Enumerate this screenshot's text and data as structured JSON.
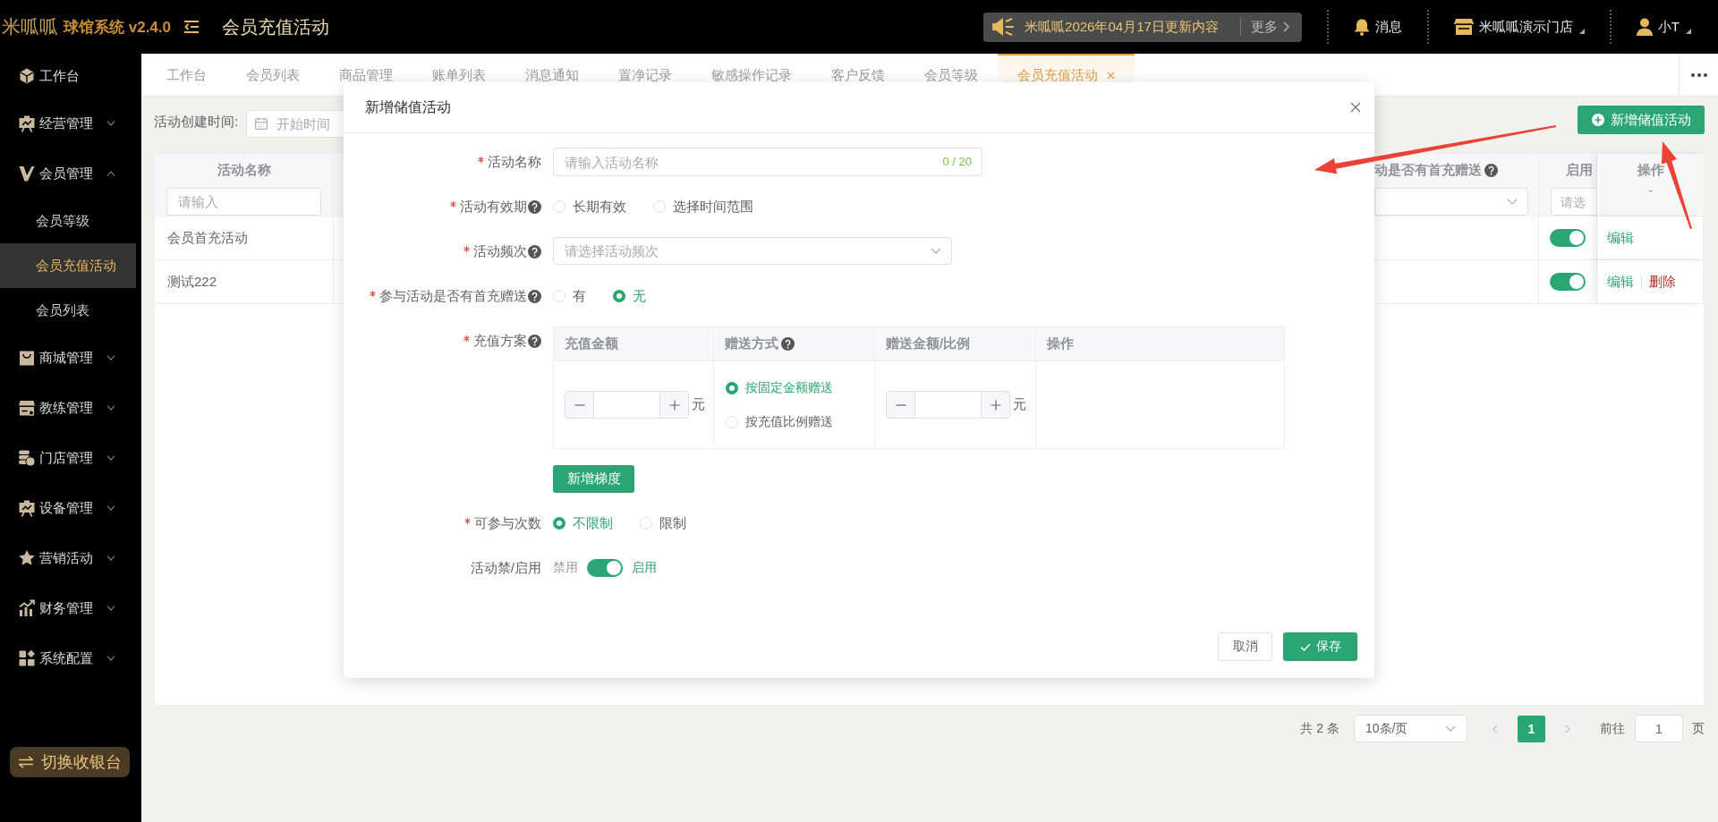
{
  "header": {
    "logo": "米呱呱",
    "app_name": "球馆系统 v2.4.0",
    "page_title": "会员充值活动",
    "notice": {
      "text": "米呱呱2026年04月17日更新内容",
      "more": "更多"
    },
    "messages": "消息",
    "store": "米呱呱演示门店",
    "user": "小T"
  },
  "sidebar": {
    "items": [
      {
        "label": "工作台",
        "kind": "link",
        "selected": false
      },
      {
        "label": "经营管理",
        "kind": "group",
        "expanded": false,
        "selected": false
      },
      {
        "label": "会员管理",
        "kind": "group",
        "expanded": true,
        "selected": false,
        "children": [
          {
            "label": "会员等级",
            "selected": false
          },
          {
            "label": "会员充值活动",
            "selected": true
          },
          {
            "label": "会员列表",
            "selected": false
          }
        ]
      },
      {
        "label": "商城管理",
        "kind": "group",
        "expanded": false,
        "selected": false
      },
      {
        "label": "教练管理",
        "kind": "group",
        "expanded": false,
        "selected": false
      },
      {
        "label": "门店管理",
        "kind": "group",
        "expanded": false,
        "selected": false
      },
      {
        "label": "设备管理",
        "kind": "group",
        "expanded": false,
        "selected": false
      },
      {
        "label": "营销活动",
        "kind": "group",
        "expanded": false,
        "selected": false
      },
      {
        "label": "财务管理",
        "kind": "group",
        "expanded": false,
        "selected": false
      },
      {
        "label": "系统配置",
        "kind": "group",
        "expanded": false,
        "selected": false
      }
    ],
    "switch_button": "切换收银台"
  },
  "tabs": [
    {
      "label": "工作台",
      "selected": false
    },
    {
      "label": "会员列表",
      "selected": false
    },
    {
      "label": "商品管理",
      "selected": false
    },
    {
      "label": "账单列表",
      "selected": false
    },
    {
      "label": "消息通知",
      "selected": false
    },
    {
      "label": "置净记录",
      "selected": false
    },
    {
      "label": "敏感操作记录",
      "selected": false
    },
    {
      "label": "客户反馈",
      "selected": false
    },
    {
      "label": "会员等级",
      "selected": false
    },
    {
      "label": "会员充值活动",
      "selected": true
    }
  ],
  "filter": {
    "label": "活动创建时间:",
    "date_placeholder": "开始时间"
  },
  "add_button": "新增储值活动",
  "table": {
    "columns": [
      {
        "title": "活动名称",
        "help": false,
        "filter": {
          "kind": "input",
          "placeholder": "请输入"
        }
      },
      {
        "title": "动是否有首充赠送",
        "help": true,
        "filter": {
          "kind": "select"
        }
      },
      {
        "title": "启用",
        "help": false,
        "filter": {
          "kind": "select",
          "placeholder": "请选"
        }
      },
      {
        "title": "操作",
        "help": false,
        "subtitle": "-"
      }
    ],
    "rows": [
      {
        "name": "会员首充活动",
        "enabled": true,
        "actions": [
          {
            "label": "编辑",
            "kind": "edit"
          }
        ]
      },
      {
        "name": "测试222",
        "enabled": true,
        "actions": [
          {
            "label": "编辑",
            "kind": "edit"
          },
          {
            "label": "删除",
            "kind": "delete"
          }
        ]
      }
    ]
  },
  "pagination": {
    "total": "共 2 条",
    "page_size": "10条/页",
    "prev_disabled": true,
    "pages": [
      {
        "label": "1",
        "selected": true
      }
    ],
    "next_disabled": true,
    "goto_label": "前往",
    "goto_value": "1",
    "page_unit": "页"
  },
  "dialog": {
    "title": "新增储值活动",
    "fields": [
      {
        "kind": "text",
        "label": "活动名称",
        "required": true,
        "help": false,
        "placeholder": "请输入活动名称",
        "counter": "0 / 20"
      },
      {
        "kind": "radio",
        "label": "活动有效期",
        "required": true,
        "help": true,
        "options": [
          {
            "label": "长期有效",
            "selected": false
          },
          {
            "label": "选择时间范围",
            "selected": false
          }
        ]
      },
      {
        "kind": "select",
        "label": "活动频次",
        "required": true,
        "help": true,
        "placeholder": "请选择活动频次"
      },
      {
        "kind": "radio",
        "label": "参与活动是否有首充赠送",
        "required": true,
        "help": true,
        "options": [
          {
            "label": "有",
            "selected": false
          },
          {
            "label": "无",
            "selected": true
          }
        ]
      },
      {
        "kind": "plan",
        "label": "充值方案",
        "required": true,
        "help": true,
        "columns": [
          {
            "title": "充值金额",
            "help": false
          },
          {
            "title": "赠送方式",
            "help": true
          },
          {
            "title": "赠送金额/比例",
            "help": false
          },
          {
            "title": "操作",
            "help": false
          }
        ],
        "rows": [
          {
            "amount_unit": "元",
            "gift_options": [
              {
                "label": "按固定金额赠送",
                "selected": true
              },
              {
                "label": "按充值比例赠送",
                "selected": false
              }
            ],
            "gift_unit": "元"
          }
        ],
        "add_button": "新增梯度"
      },
      {
        "kind": "radio",
        "label": "可参与次数",
        "required": true,
        "help": false,
        "options": [
          {
            "label": "不限制",
            "selected": true
          },
          {
            "label": "限制",
            "selected": false
          }
        ]
      },
      {
        "kind": "switch",
        "label": "活动禁/启用",
        "required": false,
        "help": false,
        "off_text": "禁用",
        "on_text": "启用",
        "on": true
      }
    ],
    "buttons": [
      {
        "label": "取消",
        "kind": "default"
      },
      {
        "label": "保存",
        "kind": "primary"
      }
    ]
  }
}
